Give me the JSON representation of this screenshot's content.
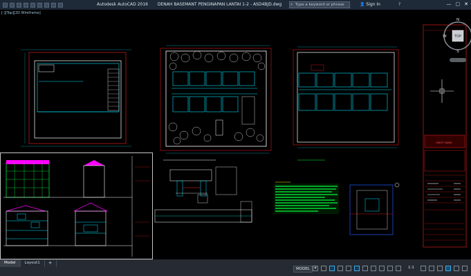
{
  "app": {
    "title": "Autodesk AutoCAD 2016",
    "document": "DENAH BASEMANT PENGINAPAN LANTAI 1-2 - ASD4BJD.dwg",
    "search_placeholder": "Type a keyword or phrase",
    "sign_in": "Sign In"
  },
  "viewport": {
    "label": "[-][Top][2D Wireframe]"
  },
  "viewcube": {
    "north": "N",
    "west": "W",
    "top": "TOP",
    "south": "S"
  },
  "sheet": {
    "title_box": "SHEET NAME"
  },
  "tabs": [
    {
      "label": "Model"
    },
    {
      "label": "Layout1"
    },
    {
      "label": "+"
    }
  ],
  "status": {
    "model": "MODEL",
    "scale": "1:1"
  },
  "colors": {
    "background": "#000000",
    "cyan": "#00e5ff",
    "magenta": "#ff00ff",
    "green": "#00ff40",
    "red": "#ff2020",
    "white": "#ffffff",
    "titlebar": "#1f2a38"
  }
}
